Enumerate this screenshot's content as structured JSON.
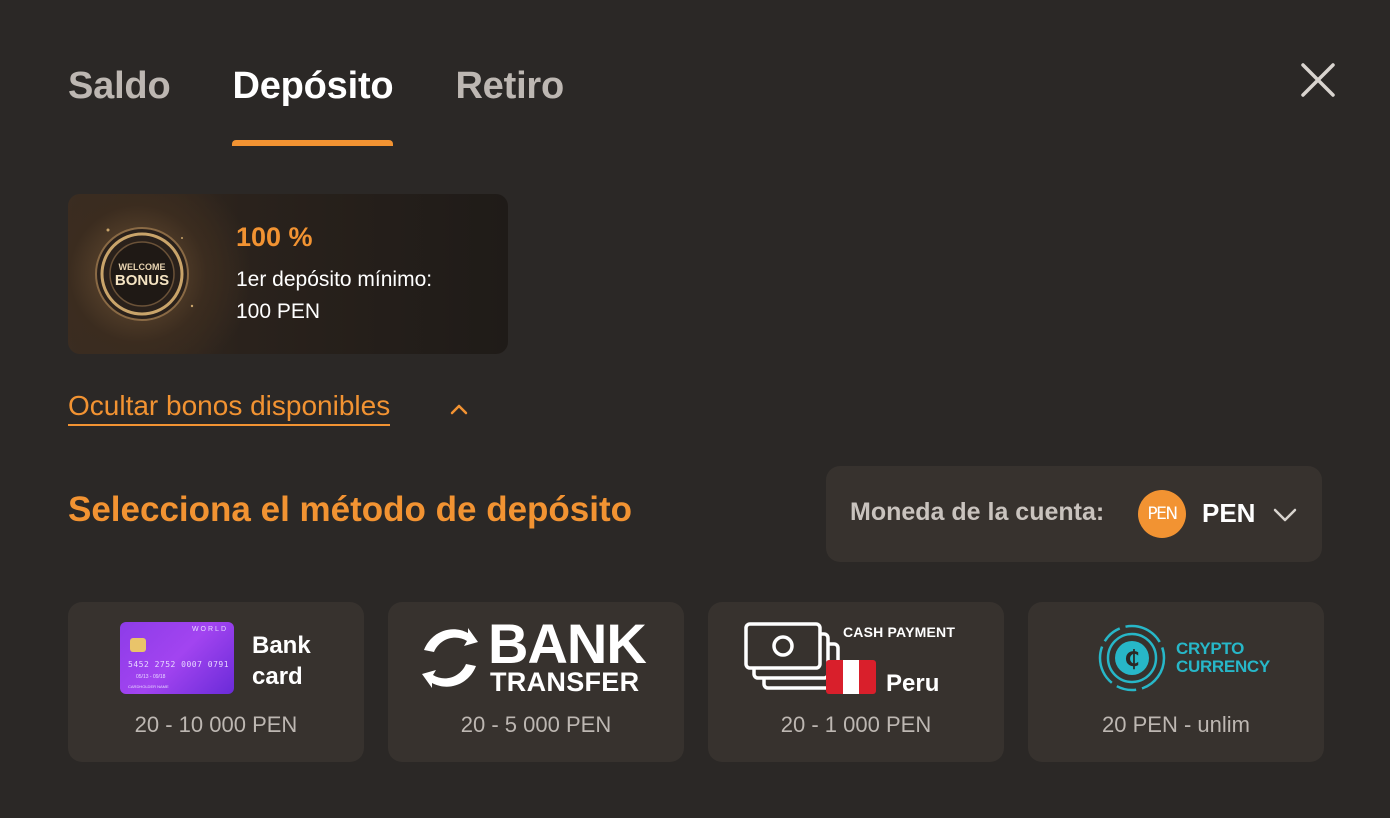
{
  "tabs": [
    {
      "label": "Saldo",
      "active": false
    },
    {
      "label": "Depósito",
      "active": true
    },
    {
      "label": "Retiro",
      "active": false
    }
  ],
  "close_icon": "close-icon",
  "bonus": {
    "emblem_text_line1": "WELCOME",
    "emblem_text_line2": "BONUS",
    "percent": "100 %",
    "description_line1": "1er depósito mínimo:",
    "description_line2": "100 PEN"
  },
  "hide_bonuses_label": "Ocultar bonos disponibles",
  "section_title": "Selecciona el método de depósito",
  "currency": {
    "label": "Moneda de la cuenta:",
    "badge": "PEN",
    "code": "PEN"
  },
  "methods": [
    {
      "name": "Bank card",
      "label_line1": "Bank",
      "label_line2": "card",
      "card_brand": "WORLD",
      "card_number": "5452 2752 0007 0791",
      "card_date": "05/13 - 09/18",
      "card_holder": "CARDHOLDER NAME",
      "range": "20 - 10 000 PEN"
    },
    {
      "name": "Bank transfer",
      "label_line1": "BANK",
      "label_line2": "TRANSFER",
      "range": "20 - 5 000 PEN"
    },
    {
      "name": "Cash payment Peru",
      "label_line1": "CASH PAYMENT",
      "label_line2": "Peru",
      "range": "20 - 1 000 PEN"
    },
    {
      "name": "Crypto currency",
      "label_line1": "CRYPTO",
      "label_line2": "CURRENCY",
      "range": "20 PEN - unlim"
    }
  ],
  "colors": {
    "background": "#2b2826",
    "accent": "#f29332",
    "card_bg": "#37322e",
    "crypto": "#27b7c8"
  }
}
